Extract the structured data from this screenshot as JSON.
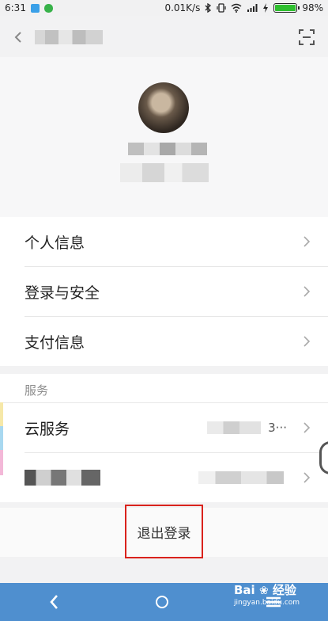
{
  "status_bar": {
    "time": "6:31",
    "speed": "0.01K/s",
    "battery_percent": "98%",
    "battery_level": 0.98,
    "icons": [
      "app-notification-icon",
      "app-notification-icon-2",
      "bluetooth-icon",
      "vibrate-icon",
      "wifi-icon",
      "signal-icon",
      "charging-icon",
      "battery-icon"
    ]
  },
  "top_bar": {
    "back_icon": "back-arrow-icon",
    "scan_icon": "scan-icon"
  },
  "menu_group_1": [
    {
      "label": "个人信息"
    },
    {
      "label": "登录与安全"
    },
    {
      "label": "支付信息"
    }
  ],
  "services": {
    "title": "服务",
    "items": [
      {
        "label": "云服务",
        "value": "3···"
      }
    ]
  },
  "logout": {
    "label": "退出登录"
  },
  "watermark": {
    "brand": "Bai",
    "brand_cn": "经验",
    "site": "jingyan.baidu.com"
  },
  "colors": {
    "accent_nav": "#4f8fcf",
    "highlight_border": "#d9221c",
    "battery_green": "#2fbf2f"
  }
}
